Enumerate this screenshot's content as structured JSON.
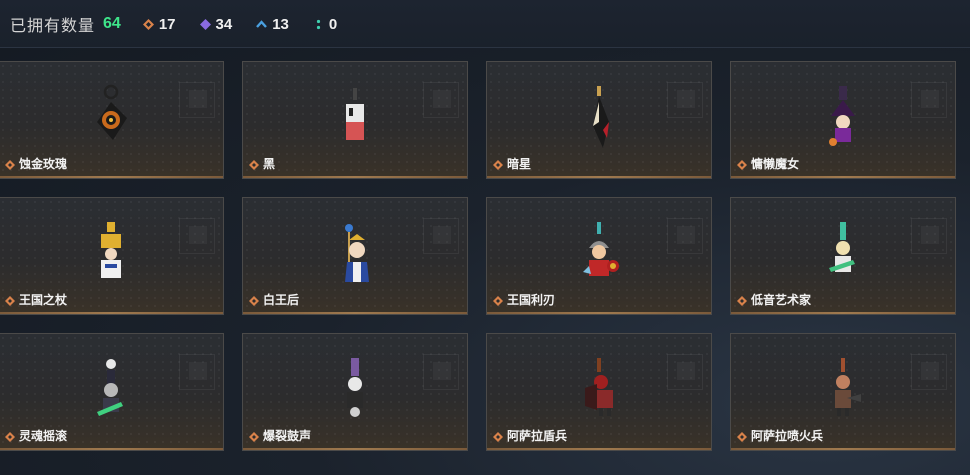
{
  "header": {
    "owned_label": "已拥有数量",
    "owned_count": "64",
    "stats": [
      {
        "icon": "orange-diamond-icon",
        "value": "17",
        "color": "#d9824a"
      },
      {
        "icon": "purple-diamond-icon",
        "value": "34",
        "color": "#8a6ae0"
      },
      {
        "icon": "blue-chevron-icon",
        "value": "13",
        "color": "#4aa0e0"
      },
      {
        "icon": "teal-dots-icon",
        "value": "0",
        "color": "#3fd0b0"
      }
    ]
  },
  "items": [
    {
      "name": "蚀金玫瑰",
      "rarity_color": "#d9824a"
    },
    {
      "name": "黑",
      "rarity_color": "#d9824a"
    },
    {
      "name": "暗星",
      "rarity_color": "#d9824a"
    },
    {
      "name": "慵懒魔女",
      "rarity_color": "#d9824a"
    },
    {
      "name": "王国之杖",
      "rarity_color": "#d9824a"
    },
    {
      "name": "白王后",
      "rarity_color": "#d9824a"
    },
    {
      "name": "王国利刃",
      "rarity_color": "#d9824a"
    },
    {
      "name": "低音艺术家",
      "rarity_color": "#d9824a"
    },
    {
      "name": "灵魂摇滚",
      "rarity_color": "#d9824a"
    },
    {
      "name": "爆裂鼓声",
      "rarity_color": "#d9824a"
    },
    {
      "name": "阿萨拉盾兵",
      "rarity_color": "#d9824a"
    },
    {
      "name": "阿萨拉喷火兵",
      "rarity_color": "#d9824a"
    }
  ]
}
